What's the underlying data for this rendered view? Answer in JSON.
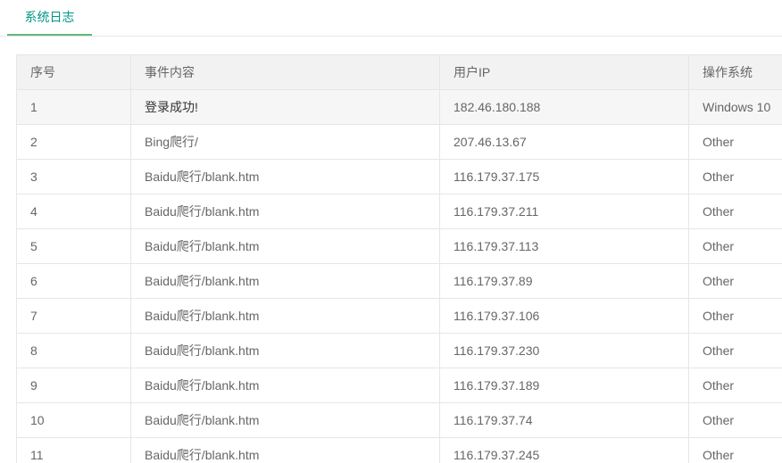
{
  "tabs": [
    {
      "label": "系统日志",
      "active": true
    }
  ],
  "accent_color": "#009688",
  "underline_color": "#5FB878",
  "table": {
    "headers": [
      "序号",
      "事件内容",
      "用户IP",
      "操作系统"
    ],
    "rows": [
      [
        "1",
        "登录成功!",
        "182.46.180.188",
        "Windows 10"
      ],
      [
        "2",
        "Bing爬行/",
        "207.46.13.67",
        "Other"
      ],
      [
        "3",
        "Baidu爬行/blank.htm",
        "116.179.37.175",
        "Other"
      ],
      [
        "4",
        "Baidu爬行/blank.htm",
        "116.179.37.211",
        "Other"
      ],
      [
        "5",
        "Baidu爬行/blank.htm",
        "116.179.37.113",
        "Other"
      ],
      [
        "6",
        "Baidu爬行/blank.htm",
        "116.179.37.89",
        "Other"
      ],
      [
        "7",
        "Baidu爬行/blank.htm",
        "116.179.37.106",
        "Other"
      ],
      [
        "8",
        "Baidu爬行/blank.htm",
        "116.179.37.230",
        "Other"
      ],
      [
        "9",
        "Baidu爬行/blank.htm",
        "116.179.37.189",
        "Other"
      ],
      [
        "10",
        "Baidu爬行/blank.htm",
        "116.179.37.74",
        "Other"
      ],
      [
        "11",
        "Baidu爬行/blank.htm",
        "116.179.37.245",
        "Other"
      ]
    ]
  }
}
